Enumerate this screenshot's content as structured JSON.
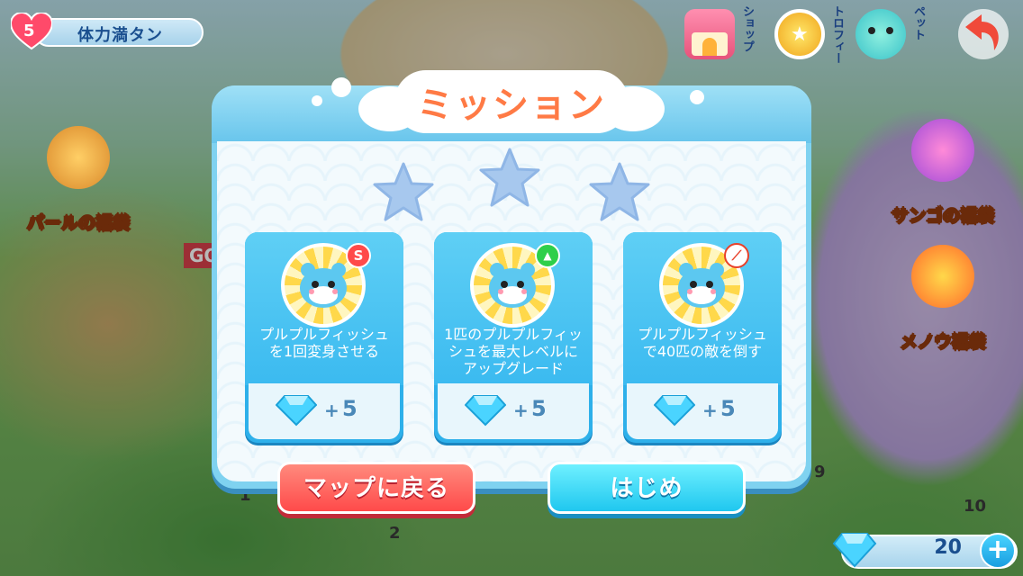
{
  "hud": {
    "stamina_count": "5",
    "stamina_label": "体力満タン",
    "shop_label": "ショップ",
    "trophy_label": "トロフィー",
    "pet_label": "ペット",
    "gem_total": "20"
  },
  "side": {
    "pearl_bag": "パールの福袋",
    "coral_bag": "サンゴの福袋",
    "agate_bag": "メノウ福袋"
  },
  "map": {
    "goal_sign": "GO",
    "node_labels": [
      "1",
      "2",
      "9",
      "10"
    ]
  },
  "dialog": {
    "title": "ミッション",
    "missions": [
      {
        "badge": "S",
        "description": "プルプルフィッシュを1回変身させる",
        "reward_plus": "+",
        "reward_amount": "5"
      },
      {
        "badge": "▲",
        "description": "1匹のプルプルフィッシュを最大レベルにアップグレード",
        "reward_plus": "+",
        "reward_amount": "5"
      },
      {
        "badge": "⟋",
        "description": "プルプルフィッシュで40匹の敵を倒す",
        "reward_plus": "+",
        "reward_amount": "5"
      }
    ],
    "back_button": "マップに戻る",
    "start_button": "はじめ"
  },
  "colors": {
    "accent_title": "#ff7a45",
    "red_button": "#ff4a4a",
    "blue_button": "#1fc7ef",
    "card_blue": "#3bbaf0"
  }
}
